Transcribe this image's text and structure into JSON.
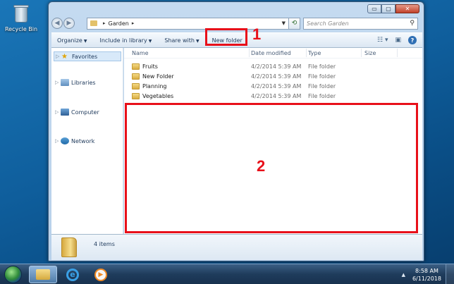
{
  "desktop": {
    "recycle_bin_label": "Recycle Bin"
  },
  "window": {
    "controls": {
      "minimize": "▭",
      "maximize": "▢",
      "close": "✕"
    },
    "address": {
      "root_separator": "▸",
      "folder": "Garden",
      "trail_separator": "▸"
    },
    "search_placeholder": "Search Garden"
  },
  "toolbar": {
    "organize": "Organize",
    "include_in_library": "Include in library",
    "share_with": "Share with",
    "new_folder": "New folder"
  },
  "nav_pane": {
    "favorites": "Favorites",
    "libraries": "Libraries",
    "computer": "Computer",
    "network": "Network"
  },
  "columns": {
    "name": "Name",
    "date_modified": "Date modified",
    "type": "Type",
    "size": "Size"
  },
  "files": [
    {
      "name": "Fruits",
      "date": "4/2/2014 5:39 AM",
      "type": "File folder"
    },
    {
      "name": "New Folder",
      "date": "4/2/2014 5:39 AM",
      "type": "File folder"
    },
    {
      "name": "Planning",
      "date": "4/2/2014 5:39 AM",
      "type": "File folder"
    },
    {
      "name": "Vegetables",
      "date": "4/2/2014 5:39 AM",
      "type": "File folder"
    }
  ],
  "details": {
    "item_count": "4 items"
  },
  "annotations": {
    "label_1": "1",
    "label_2": "2",
    "color": "#e8101a"
  },
  "taskbar": {
    "time": "8:58 AM",
    "date": "6/11/2018"
  }
}
